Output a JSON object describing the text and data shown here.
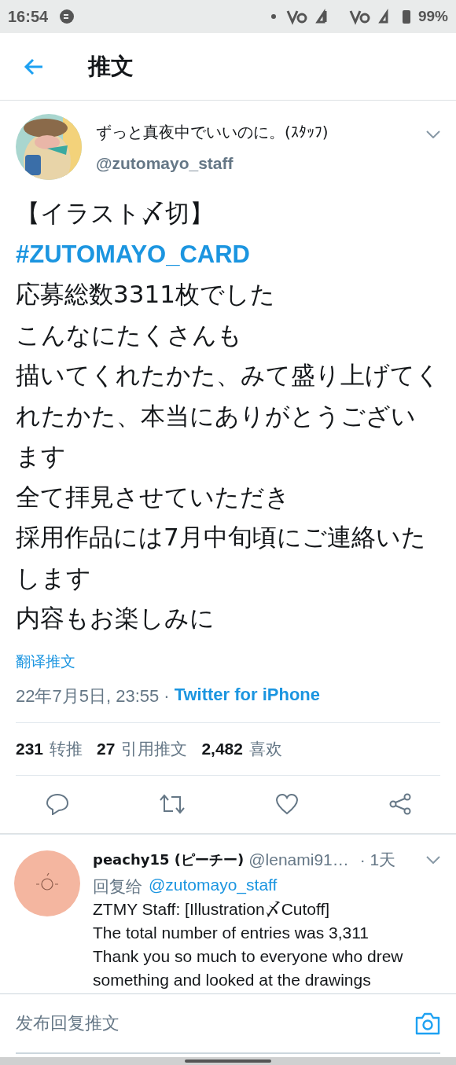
{
  "status_bar": {
    "time": "16:54",
    "battery": "99%"
  },
  "header": {
    "title": "推文"
  },
  "tweet": {
    "author": {
      "name": "ずっと真夜中でいいのに。(ｽﾀｯﾌ)",
      "handle": "@zutomayo_staff"
    },
    "lines": [
      {
        "kind": "text",
        "text": "【イラスト〆切】"
      },
      {
        "kind": "hashtag",
        "text": "#ZUTOMAYO_CARD"
      },
      {
        "kind": "text",
        "text": "応募総数3311枚でした"
      },
      {
        "kind": "text",
        "text": "こんなにたくさんも"
      },
      {
        "kind": "text",
        "text": "描いてくれたかた、みて盛り上げてくれたかた、本当にありがとうございます"
      },
      {
        "kind": "text",
        "text": "全て拝見させていただき"
      },
      {
        "kind": "text",
        "text": "採用作品には7月中旬頃にご連絡いたします"
      },
      {
        "kind": "text",
        "text": "内容もお楽しみに"
      }
    ],
    "translate": "翻译推文",
    "date": "22年7月5日, 23:55 ·",
    "source": "Twitter for iPhone",
    "stats": [
      {
        "count": "231",
        "label": "转推"
      },
      {
        "count": "27",
        "label": "引用推文"
      },
      {
        "count": "2,482",
        "label": "喜欢"
      }
    ]
  },
  "reply": {
    "name": "peachy15 (ピーチー)",
    "handle": "@lenami91…",
    "time": "· 1天",
    "reply_to_label": "回复给",
    "reply_to": "@zutomayo_staff",
    "lines": [
      "ZTMY Staff: [Illustration〆Cutoff]",
      "The total number of entries was 3,311",
      "Thank you so much to everyone who drew",
      "something and looked at the drawings"
    ]
  },
  "composer": {
    "placeholder": "发布回复推文"
  }
}
